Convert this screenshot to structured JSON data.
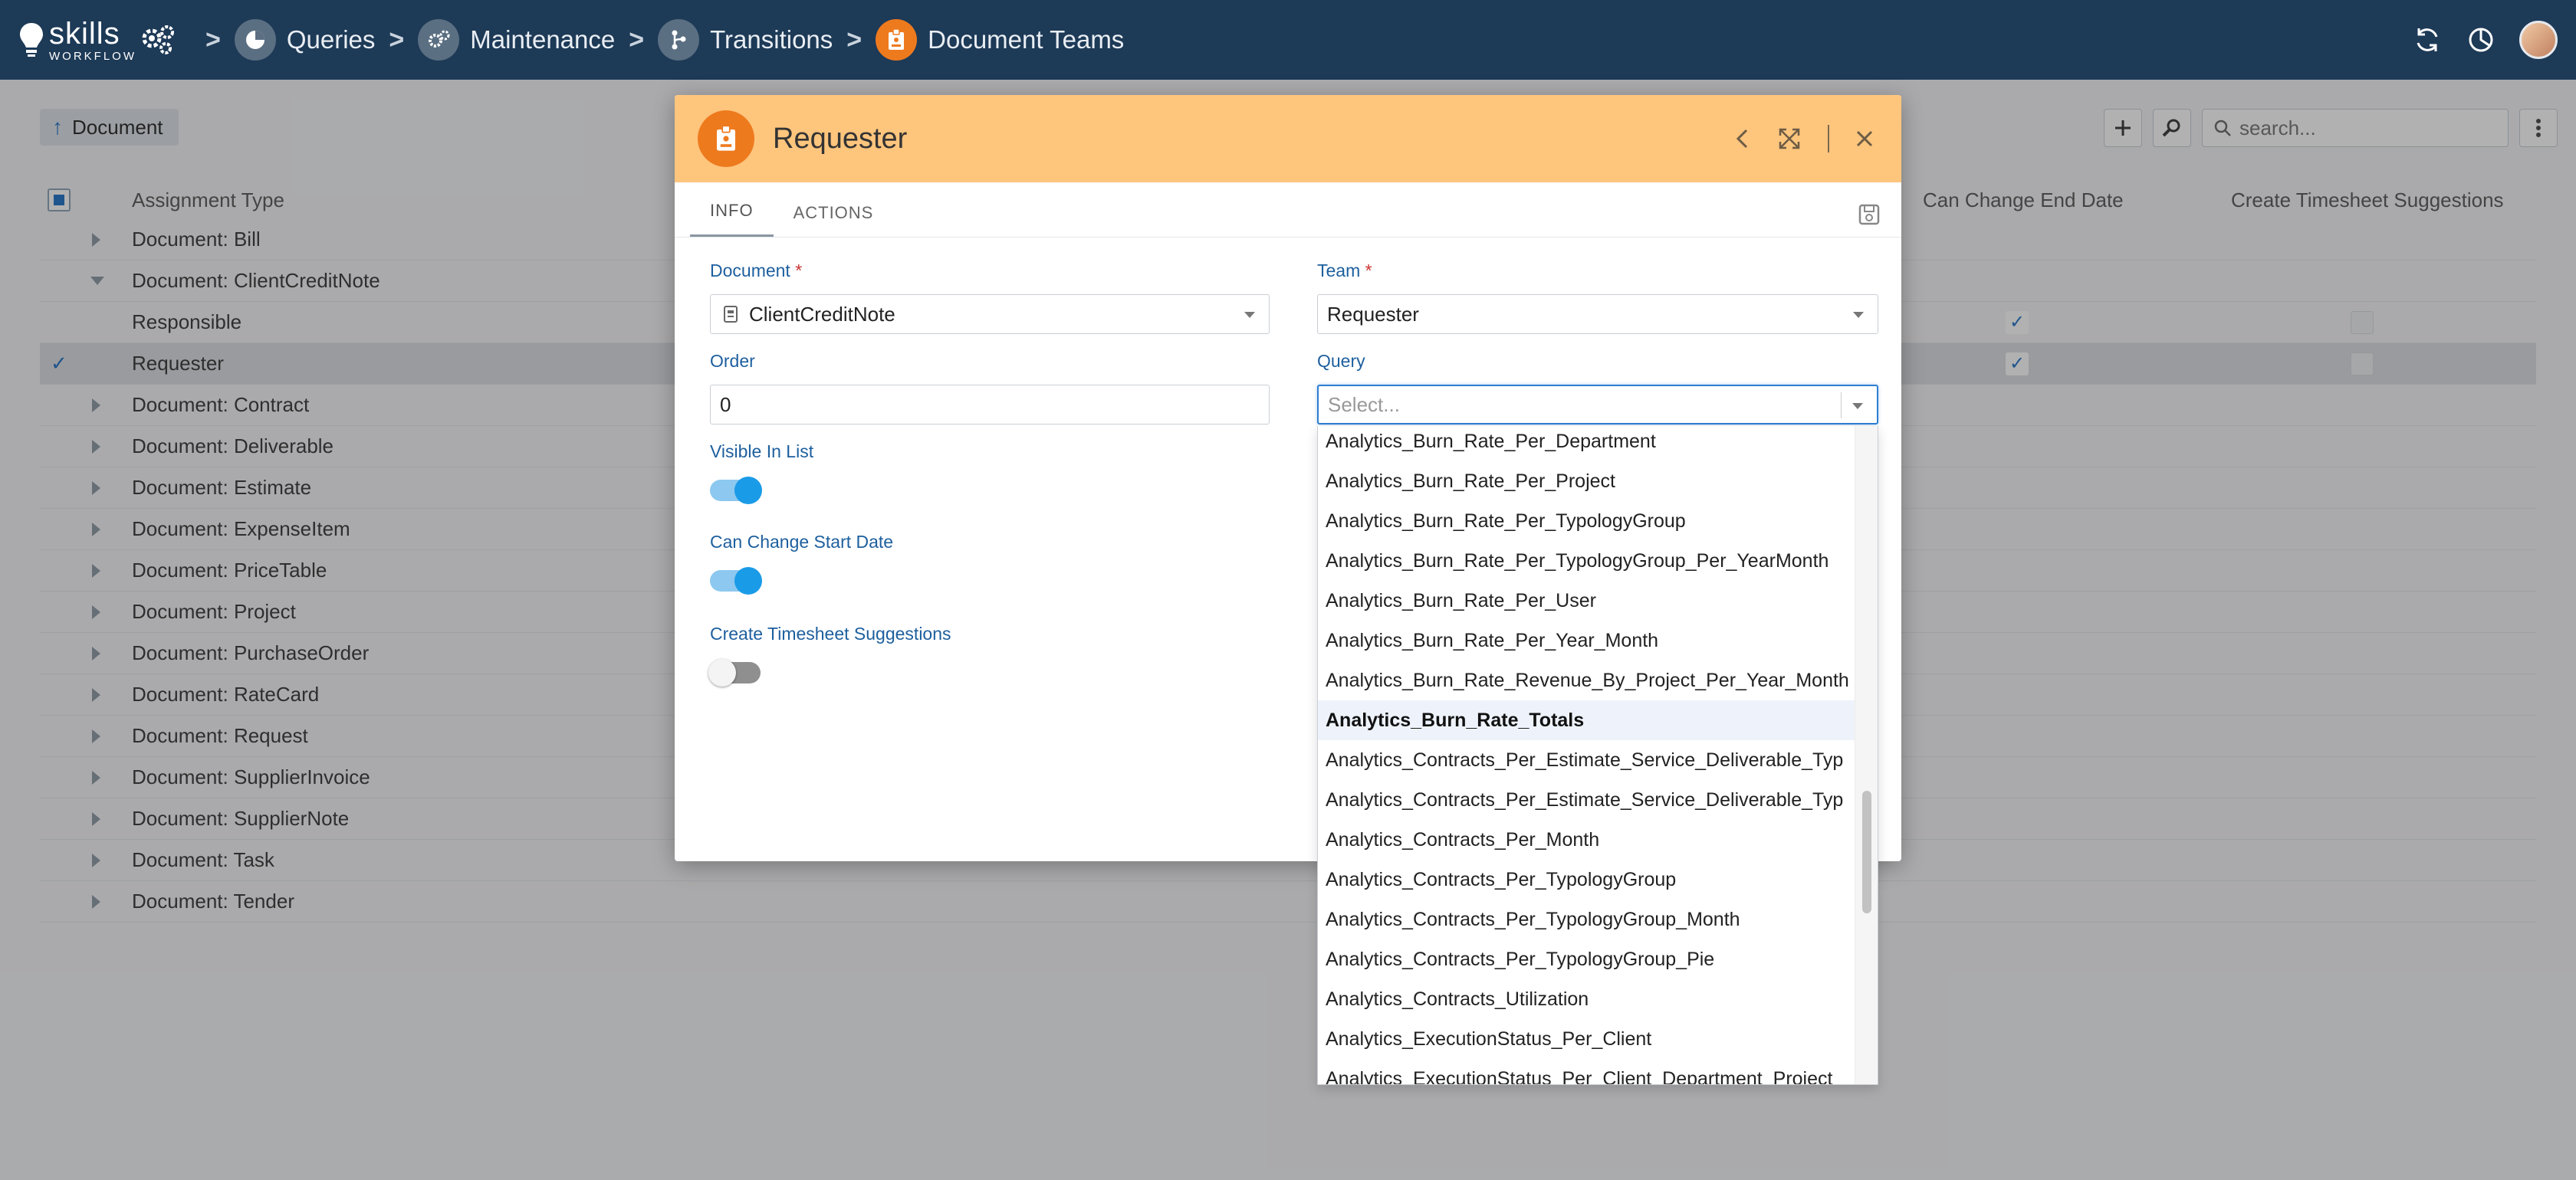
{
  "topbar": {
    "logo_main": "skills",
    "logo_sub": "WORKFLOW",
    "breadcrumbs": [
      {
        "label": "Queries",
        "icon": "pie-chart-icon"
      },
      {
        "label": "Maintenance",
        "icon": "gears-icon"
      },
      {
        "label": "Transitions",
        "icon": "branch-icon"
      },
      {
        "label": "Document Teams",
        "icon": "badge-icon"
      }
    ]
  },
  "page": {
    "document_chip": "Document",
    "search_placeholder": "search...",
    "columns": {
      "assignment_type": "Assignment Type",
      "can_change_end_date": "Can Change End Date",
      "create_timesheet_suggestions": "Create Timesheet Suggestions"
    },
    "rows": [
      {
        "label": "Document: Bill",
        "kind": "group"
      },
      {
        "label": "Document: ClientCreditNote",
        "kind": "group-open"
      },
      {
        "label": "Responsible",
        "kind": "child"
      },
      {
        "label": "Requester",
        "kind": "child-selected"
      },
      {
        "label": "Document: Contract",
        "kind": "group"
      },
      {
        "label": "Document: Deliverable",
        "kind": "group"
      },
      {
        "label": "Document: Estimate",
        "kind": "group"
      },
      {
        "label": "Document: ExpenseItem",
        "kind": "group"
      },
      {
        "label": "Document: PriceTable",
        "kind": "group"
      },
      {
        "label": "Document: Project",
        "kind": "group"
      },
      {
        "label": "Document: PurchaseOrder",
        "kind": "group"
      },
      {
        "label": "Document: RateCard",
        "kind": "group"
      },
      {
        "label": "Document: Request",
        "kind": "group"
      },
      {
        "label": "Document: SupplierInvoice",
        "kind": "group"
      },
      {
        "label": "Document: SupplierNote",
        "kind": "group"
      },
      {
        "label": "Document: Task",
        "kind": "group"
      },
      {
        "label": "Document: Tender",
        "kind": "group"
      }
    ]
  },
  "modal": {
    "title": "Requester",
    "tabs": [
      "INFO",
      "ACTIONS"
    ],
    "document_label": "Document",
    "document_value": "ClientCreditNote",
    "team_label": "Team",
    "team_value": "Requester",
    "order_label": "Order",
    "order_value": "0",
    "query_label": "Query",
    "query_placeholder": "Select...",
    "visible_in_list_label": "Visible In List",
    "visible_in_list": true,
    "can_change_start_date_label": "Can Change Start Date",
    "can_change_start_date": true,
    "create_timesheet_label": "Create Timesheet Suggestions",
    "create_timesheet": false,
    "required_mark": "*"
  },
  "query_options": [
    "Analytics_Burn_Rate_Per_Department",
    "Analytics_Burn_Rate_Per_Project",
    "Analytics_Burn_Rate_Per_TypologyGroup",
    "Analytics_Burn_Rate_Per_TypologyGroup_Per_YearMonth",
    "Analytics_Burn_Rate_Per_User",
    "Analytics_Burn_Rate_Per_Year_Month",
    "Analytics_Burn_Rate_Revenue_By_Project_Per_Year_Month",
    "Analytics_Burn_Rate_Totals",
    "Analytics_Contracts_Per_Estimate_Service_Deliverable_Typ",
    "Analytics_Contracts_Per_Estimate_Service_Deliverable_Typ",
    "Analytics_Contracts_Per_Month",
    "Analytics_Contracts_Per_TypologyGroup",
    "Analytics_Contracts_Per_TypologyGroup_Month",
    "Analytics_Contracts_Per_TypologyGroup_Pie",
    "Analytics_Contracts_Utilization",
    "Analytics_ExecutionStatus_Per_Client",
    "Analytics_ExecutionStatus_Per_Client_Department_Project"
  ],
  "highlighted_option": "Analytics_Burn_Rate_Totals",
  "colors": {
    "topbar": "#1d3a57",
    "modal_header": "#fec57d",
    "accent_orange": "#ee7a1e",
    "label_blue": "#1d5f9e",
    "toggle_on": "#1a9be8"
  }
}
